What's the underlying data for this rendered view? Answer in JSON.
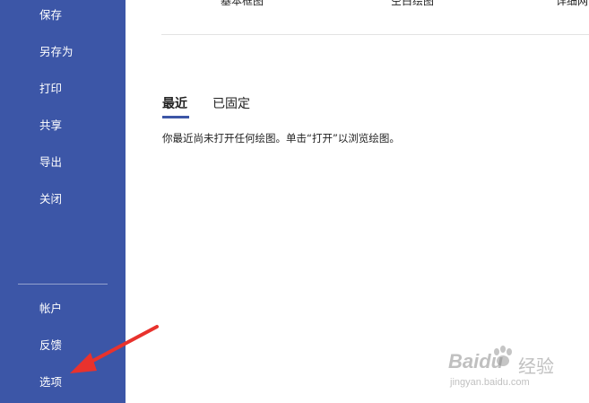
{
  "sidebar": {
    "items": [
      {
        "label": "保存"
      },
      {
        "label": "另存为"
      },
      {
        "label": "打印"
      },
      {
        "label": "共享"
      },
      {
        "label": "导出"
      },
      {
        "label": "关闭"
      }
    ],
    "bottom_items": [
      {
        "label": "帐户"
      },
      {
        "label": "反馈"
      },
      {
        "label": "选项"
      }
    ]
  },
  "templates": [
    {
      "label": "基本框图"
    },
    {
      "label": "空白绘图"
    },
    {
      "label": "详细网"
    }
  ],
  "recent": {
    "tabs": [
      {
        "label": "最近",
        "active": true
      },
      {
        "label": "已固定",
        "active": false
      }
    ],
    "empty_message": "你最近尚未打开任何绘图。单击“打开”以浏览绘图。"
  },
  "annotation": {
    "arrow_color": "#e8322d"
  },
  "watermark": {
    "brand": "Baidu",
    "service": "经验",
    "url": "jingyan.baidu.com"
  },
  "colors": {
    "sidebar_bg": "#3c56a7",
    "accent": "#3c56a7",
    "text": "#222222"
  }
}
